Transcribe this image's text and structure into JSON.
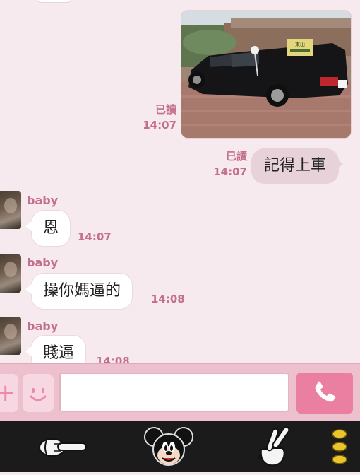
{
  "messages": {
    "outgoing_image": {
      "read_label": "已讀",
      "time": "14:07",
      "plate_text": "東山"
    },
    "outgoing_text": {
      "read_label": "已讀",
      "time": "14:07",
      "text": "記得上車"
    },
    "incoming": [
      {
        "sender": "baby",
        "text": "恩",
        "time": "14:07"
      },
      {
        "sender": "baby",
        "text": "操你媽逼的",
        "time": "14:08"
      },
      {
        "sender": "baby",
        "text": "賤逼",
        "time": "14:08"
      }
    ]
  },
  "input_bar": {
    "plus_icon": "plus-icon",
    "emoji_icon": "smile-icon",
    "message_value": "",
    "call_icon": "phone-icon"
  },
  "toolbar": {
    "items": [
      "glove-pointing-icon",
      "mickey-icon",
      "glove-peace-icon",
      "more-dots-icon"
    ]
  },
  "colors": {
    "background": "#f6eaee",
    "accent": "#c46f8b",
    "outgoing_bubble": "#e7d2d9",
    "input_bar": "#ecc0cd",
    "call_button": "#ea7fa2",
    "toolbar": "#1b1b1b"
  }
}
